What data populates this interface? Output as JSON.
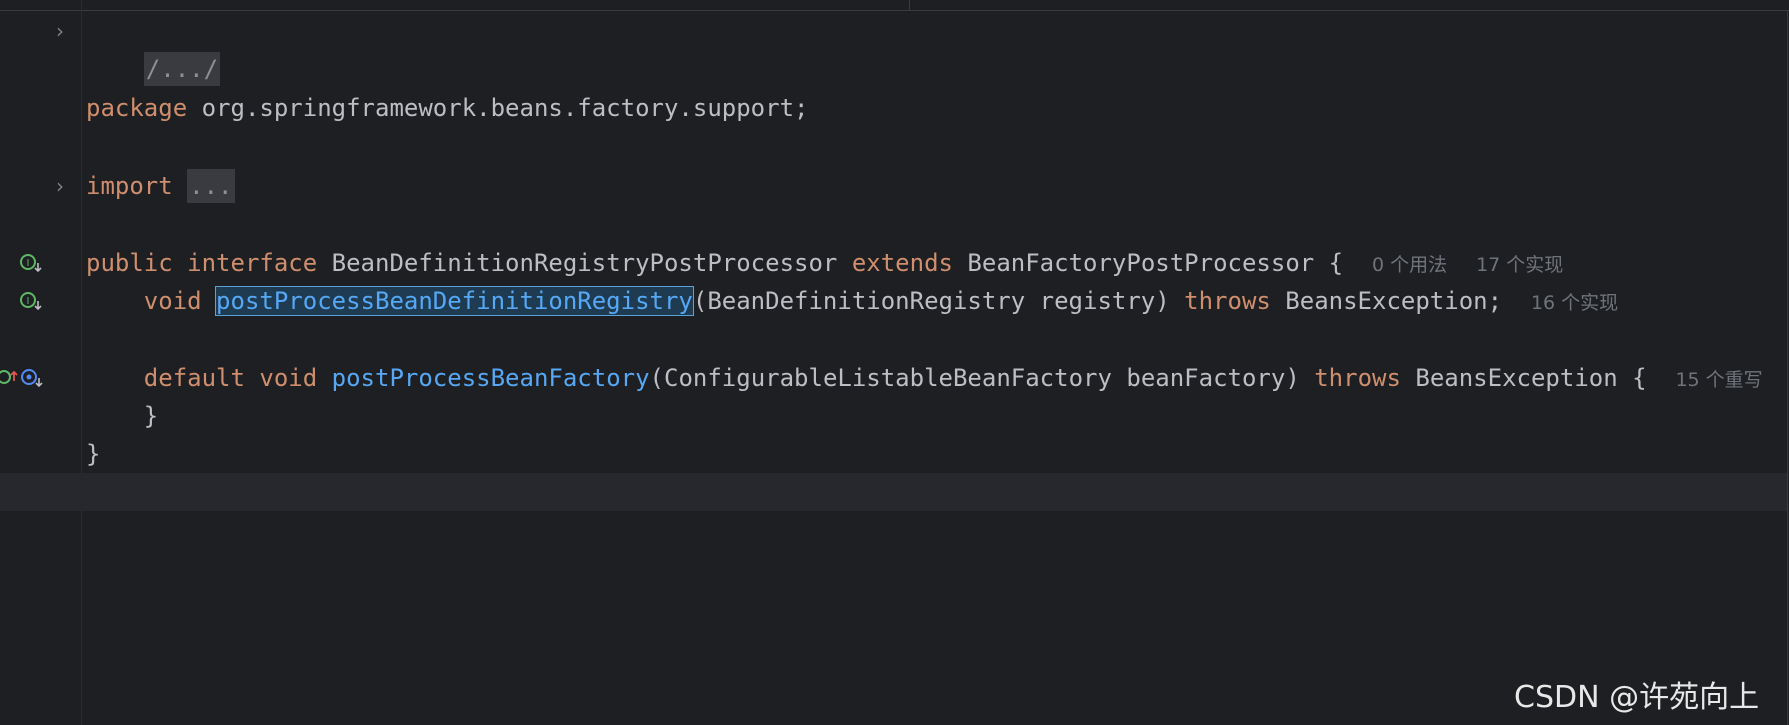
{
  "colors": {
    "background": "#1e1f22",
    "keyword": "#cf8e6d",
    "method": "#56a8f5",
    "text": "#bcbec4",
    "hint": "#6f737a"
  },
  "gutter": {
    "expand_icon": "chevron-right-icon",
    "implemented_icon": "interface-implemented-icon",
    "override_icon": "overrides-method-icon"
  },
  "code": {
    "line1": {
      "folded_header": "/.../"
    },
    "line3": {
      "kw_package": "package",
      "package_name": " org.springframework.beans.factory.support;"
    },
    "line5": {
      "kw_import": "import",
      "folded_imports": "..."
    },
    "line7": {
      "kw_public": "public",
      "kw_interface": "interface",
      "class_name": " BeanDefinitionRegistryPostProcessor ",
      "kw_extends": "extends",
      "super_type": " BeanFactoryPostProcessor {",
      "hint_usages": "0 个用法",
      "hint_impls": "17 个实现"
    },
    "line8": {
      "kw_void": "void",
      "method_name": "postProcessBeanDefinitionRegistry",
      "params": "(BeanDefinitionRegistry registry) ",
      "kw_throws": "throws",
      "exception": " BeansException;",
      "hint_impls": "16 个实现"
    },
    "line10": {
      "kw_default": "default",
      "kw_void": "void",
      "method_name": "postProcessBeanFactory",
      "params": "(ConfigurableListableBeanFactory beanFactory) ",
      "kw_throws": "throws",
      "exception": " BeansException {",
      "hint_overrides": "15 个重写"
    },
    "line11": {
      "close": "}"
    },
    "line12": {
      "close": "}"
    }
  },
  "watermark": "CSDN @许苑向上"
}
